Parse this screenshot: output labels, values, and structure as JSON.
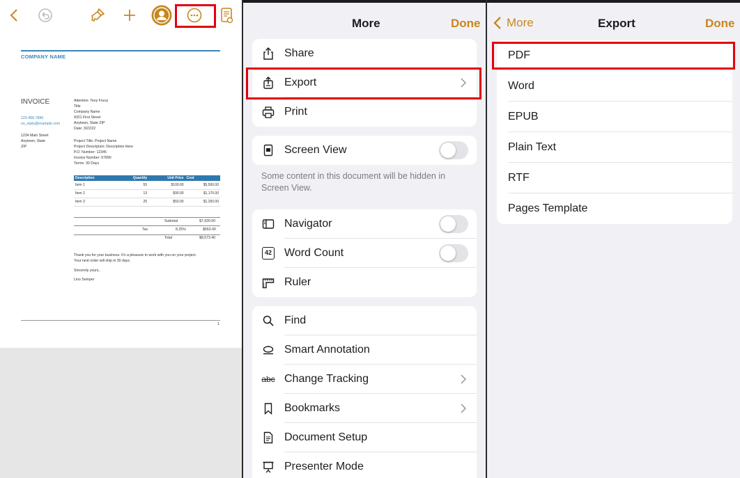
{
  "document": {
    "company_name": "COMPANY NAME",
    "invoice_title": "INVOICE",
    "phone": "123-456-7890",
    "email": "no_reply@example.com",
    "address1": "1234 Main Street",
    "address2": "Anytown, State",
    "address3": "ZIP",
    "attention": [
      "Attention: Tenz Fruca",
      "Title",
      "Company Name",
      "4321 First Street",
      "Anytown, State ZIP",
      "Date: 3/22/22"
    ],
    "project": [
      "Project Title: Project Name",
      "Project Description: Description Here",
      "P.O. Number: 12345",
      "Invoice Number: 67890",
      "Terms: 30 Days"
    ],
    "table": {
      "headers": [
        "Description",
        "Quantity",
        "Unit Price",
        "Cost"
      ],
      "rows": [
        [
          "Item 1",
          "55",
          "$100.00",
          "$5,500.00"
        ],
        [
          "Item 2",
          "13",
          "$90.00",
          "$1,170.00"
        ],
        [
          "Item 3",
          "25",
          "$50.00",
          "$1,250.00"
        ]
      ]
    },
    "subtotal_label": "Subtotal",
    "subtotal_value": "$7,920.00",
    "tax_label": "Tax",
    "tax_rate": "8.25%",
    "tax_value": "$653.40",
    "total_label": "Total",
    "total_value": "$8,573.40",
    "thanks1": "Thank you for your business. It's a pleasure to work with you on your project.",
    "thanks2": "Your next order will ship in 30 days.",
    "sincerely": "Sincerely yours,",
    "signature": "Lino Semper",
    "page_number": "1"
  },
  "more_menu": {
    "title": "More",
    "done": "Done",
    "group1": [
      {
        "label": "Share",
        "icon": "share-icon"
      },
      {
        "label": "Export",
        "icon": "export-icon"
      },
      {
        "label": "Print",
        "icon": "print-icon"
      }
    ],
    "screen_view": {
      "label": "Screen View",
      "icon": "screen-view-icon"
    },
    "screen_view_note": "Some content in this document will be hidden in Screen View.",
    "group3": [
      {
        "label": "Navigator",
        "icon": "navigator-icon"
      },
      {
        "label": "Word Count",
        "icon": "word-count-icon",
        "icon_text": "42"
      },
      {
        "label": "Ruler",
        "icon": "ruler-icon"
      }
    ],
    "group4": [
      {
        "label": "Find",
        "icon": "search-icon"
      },
      {
        "label": "Smart Annotation",
        "icon": "smart-annotation-icon"
      },
      {
        "label": "Change Tracking",
        "icon": "change-tracking-icon",
        "icon_text": "abc"
      },
      {
        "label": "Bookmarks",
        "icon": "bookmark-icon"
      },
      {
        "label": "Document Setup",
        "icon": "document-setup-icon"
      },
      {
        "label": "Presenter Mode",
        "icon": "presenter-mode-icon"
      }
    ]
  },
  "export_menu": {
    "back": "More",
    "title": "Export",
    "done": "Done",
    "options": [
      "PDF",
      "Word",
      "EPUB",
      "Plain Text",
      "RTF",
      "Pages Template"
    ]
  },
  "colors": {
    "accent": "#c8861e",
    "highlight": "#e3000f",
    "doc_blue": "#3a86b8"
  }
}
